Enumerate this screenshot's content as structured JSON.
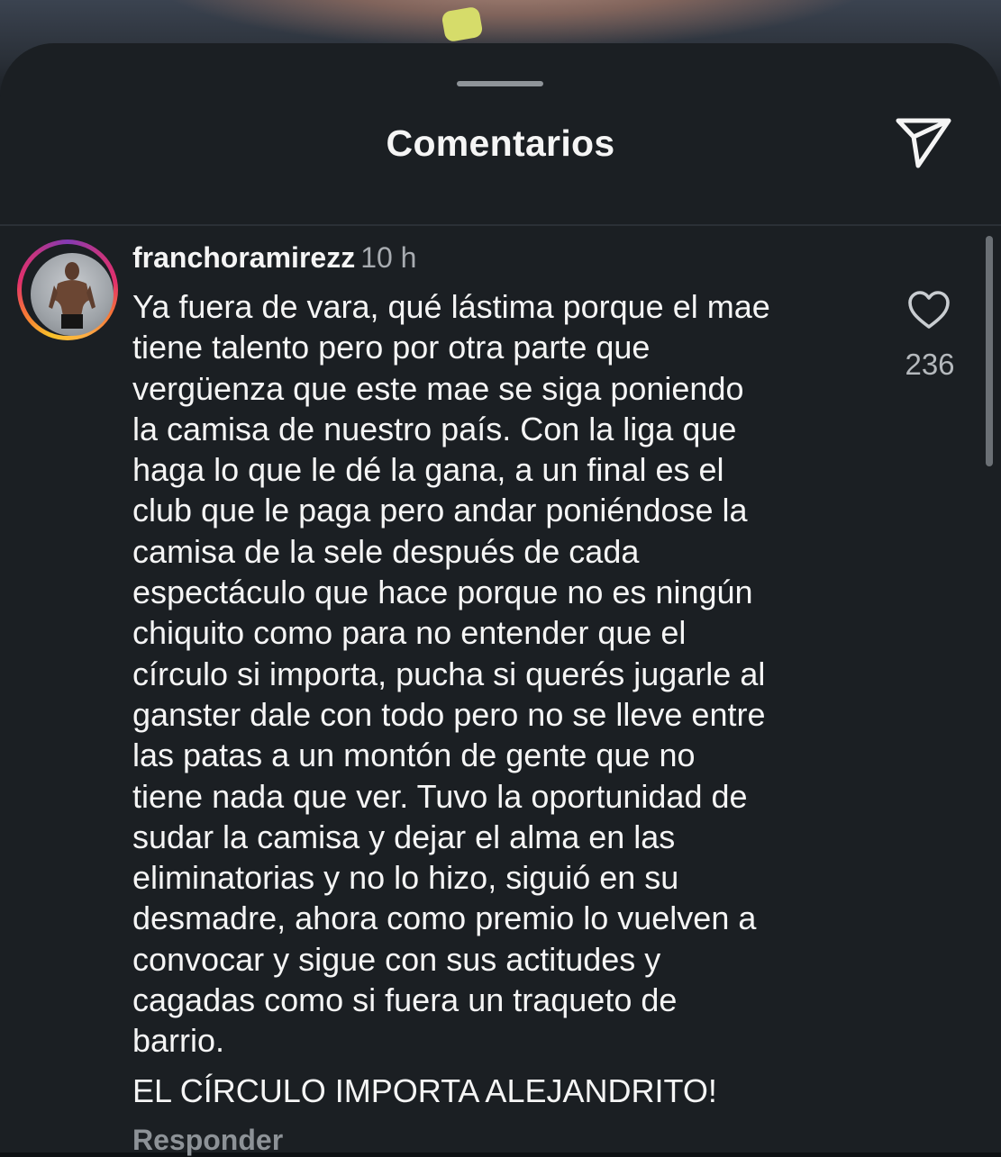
{
  "sheet": {
    "title": "Comentarios"
  },
  "comment": {
    "username": "franchoramirezz",
    "time": "10 h",
    "text": "Ya fuera de vara, qué lástima porque el mae\ntiene talento pero por otra parte que\nvergüenza que este mae se siga poniendo\nla camisa de nuestro país. Con la liga que\nhaga lo que le dé la gana, a un final es el\nclub que le paga pero andar poniéndose la\ncamisa de la sele después de cada\nespectáculo que hace porque no es ningún\nchiquito como para no entender que el\ncírculo si importa, pucha si querés jugarle al\nganster dale con todo pero no se lleve entre\nlas patas a un montón de gente que no\ntiene nada que ver. Tuvo la oportunidad de\nsudar la camisa y dejar el alma en las\neliminatorias y no lo hizo, siguió en su\ndesmadre, ahora como premio lo vuelven a\nconvocar y sigue con sus actitudes y\ncagadas como si fuera un  traqueto de\nbarrio.",
    "text_2": "EL CÍRCULO IMPORTA ALEJANDRITO!",
    "likes": "236",
    "reply_label": "Responder"
  },
  "icons": {
    "share": "paper-plane-icon",
    "like": "heart-outline-icon",
    "avatar": "user-avatar"
  },
  "colors": {
    "background": "#1b1f23",
    "text": "#f5f5f5",
    "muted": "#a8acb1"
  }
}
